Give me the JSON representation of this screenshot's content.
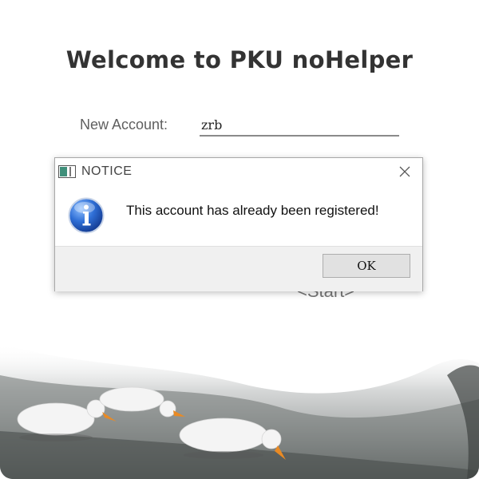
{
  "app": {
    "title": "Welcome to PKU noHelper",
    "account_label": "New Account:",
    "account_value": "zrb",
    "start_label": "<Start>"
  },
  "dialog": {
    "title": "NOTICE",
    "message": "This account has already been registered!",
    "ok_label": "OK",
    "icon": "info-icon"
  },
  "colors": {
    "dialog_icon_blue": "#1f5fc8",
    "footer_gray": "#f0f0f0",
    "button_gray": "#e1e1e1"
  }
}
